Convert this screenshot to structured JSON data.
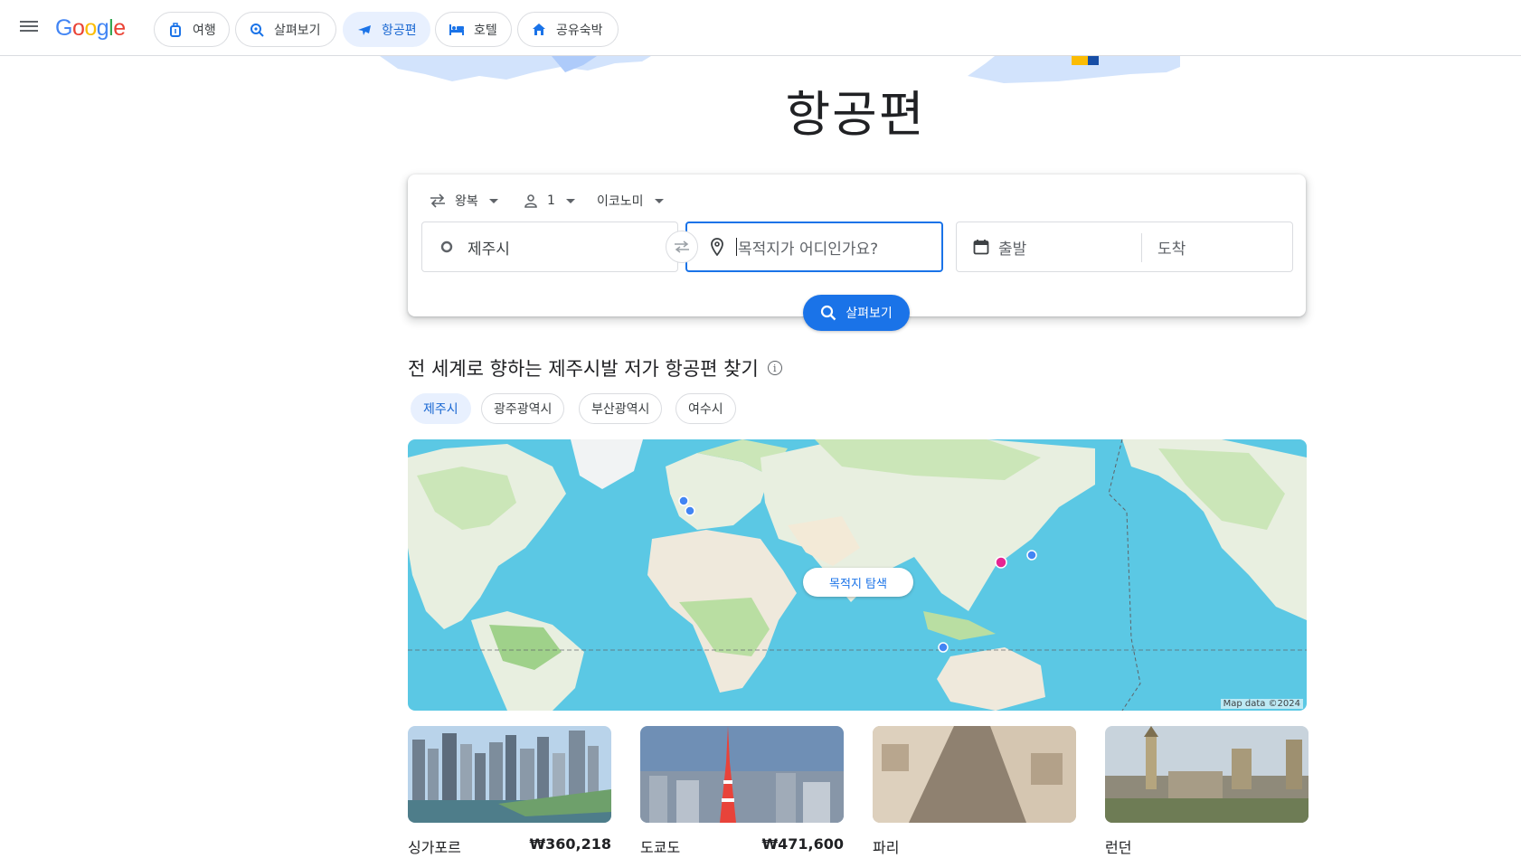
{
  "header": {
    "logo": {
      "g1": "G",
      "o1": "o",
      "o2": "o",
      "g2": "g",
      "l": "l",
      "e": "e"
    },
    "tabs": [
      {
        "label": "여행",
        "icon": "luggage-icon"
      },
      {
        "label": "살펴보기",
        "icon": "explore-icon"
      },
      {
        "label": "항공편",
        "icon": "flight-icon",
        "active": true
      },
      {
        "label": "호텔",
        "icon": "hotel-icon"
      },
      {
        "label": "공유숙박",
        "icon": "home-icon"
      }
    ]
  },
  "hero": {
    "title": "항공편"
  },
  "search": {
    "trip_type": "왕복",
    "passengers": "1",
    "cabin_class": "이코노미",
    "origin": "제주시",
    "destination_placeholder": "목적지가 어디인가요?",
    "depart_placeholder": "출발",
    "return_placeholder": "도착",
    "search_button": "살펴보기"
  },
  "explore": {
    "title": "전 세계로 향하는 제주시발 저가 항공편 찾기",
    "info_glyph": "i",
    "origins": [
      {
        "label": "제주시",
        "active": true
      },
      {
        "label": "광주광역시"
      },
      {
        "label": "부산광역시"
      },
      {
        "label": "여수시"
      }
    ],
    "map_button": "목적지 탐색",
    "map_credit": "Map data ©2024"
  },
  "destinations": [
    {
      "city": "싱가포르",
      "price": "₩360,218"
    },
    {
      "city": "도쿄도",
      "price": "₩471,600"
    },
    {
      "city": "파리",
      "price": ""
    },
    {
      "city": "런던",
      "price": ""
    }
  ],
  "colors": {
    "accent": "#1a73e8",
    "active_chip_bg": "#e8f0fe",
    "ocean": "#5bc8e4",
    "land": "#e8efe0",
    "forest": "#b9dea2",
    "origin_marker": "#e52592",
    "destination_marker": "#4285f4"
  }
}
